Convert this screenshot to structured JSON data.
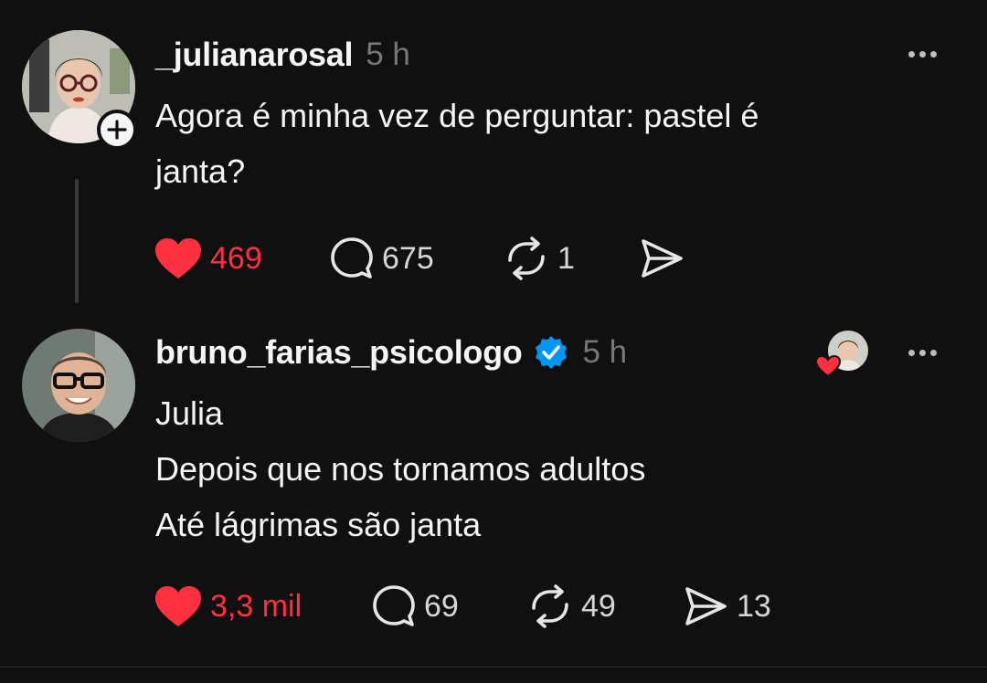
{
  "posts": [
    {
      "username": "_julianarosal",
      "time": "5 h",
      "lines": [
        "Agora é minha vez de perguntar: pastel é",
        "janta?"
      ],
      "likes": "469",
      "replies": "675",
      "reposts": "1",
      "shares": ""
    },
    {
      "username": "bruno_farias_psicologo",
      "time": "5 h",
      "lines": [
        "Julia",
        "Depois que nos tornamos adultos",
        "Até lágrimas são janta"
      ],
      "likes": "3,3 mil",
      "replies": "69",
      "reposts": "49",
      "shares": "13"
    }
  ],
  "icons": {
    "like": "heart-icon",
    "reply": "comment-icon",
    "repost": "repost-icon",
    "share": "send-icon",
    "more": "more-icon",
    "follow": "plus-icon",
    "verified": "verified-badge-icon"
  },
  "colors": {
    "background": "#101010",
    "text": "#f3f5f7",
    "muted": "#777777",
    "liked": "#ff3040",
    "verified": "#0095f6"
  }
}
